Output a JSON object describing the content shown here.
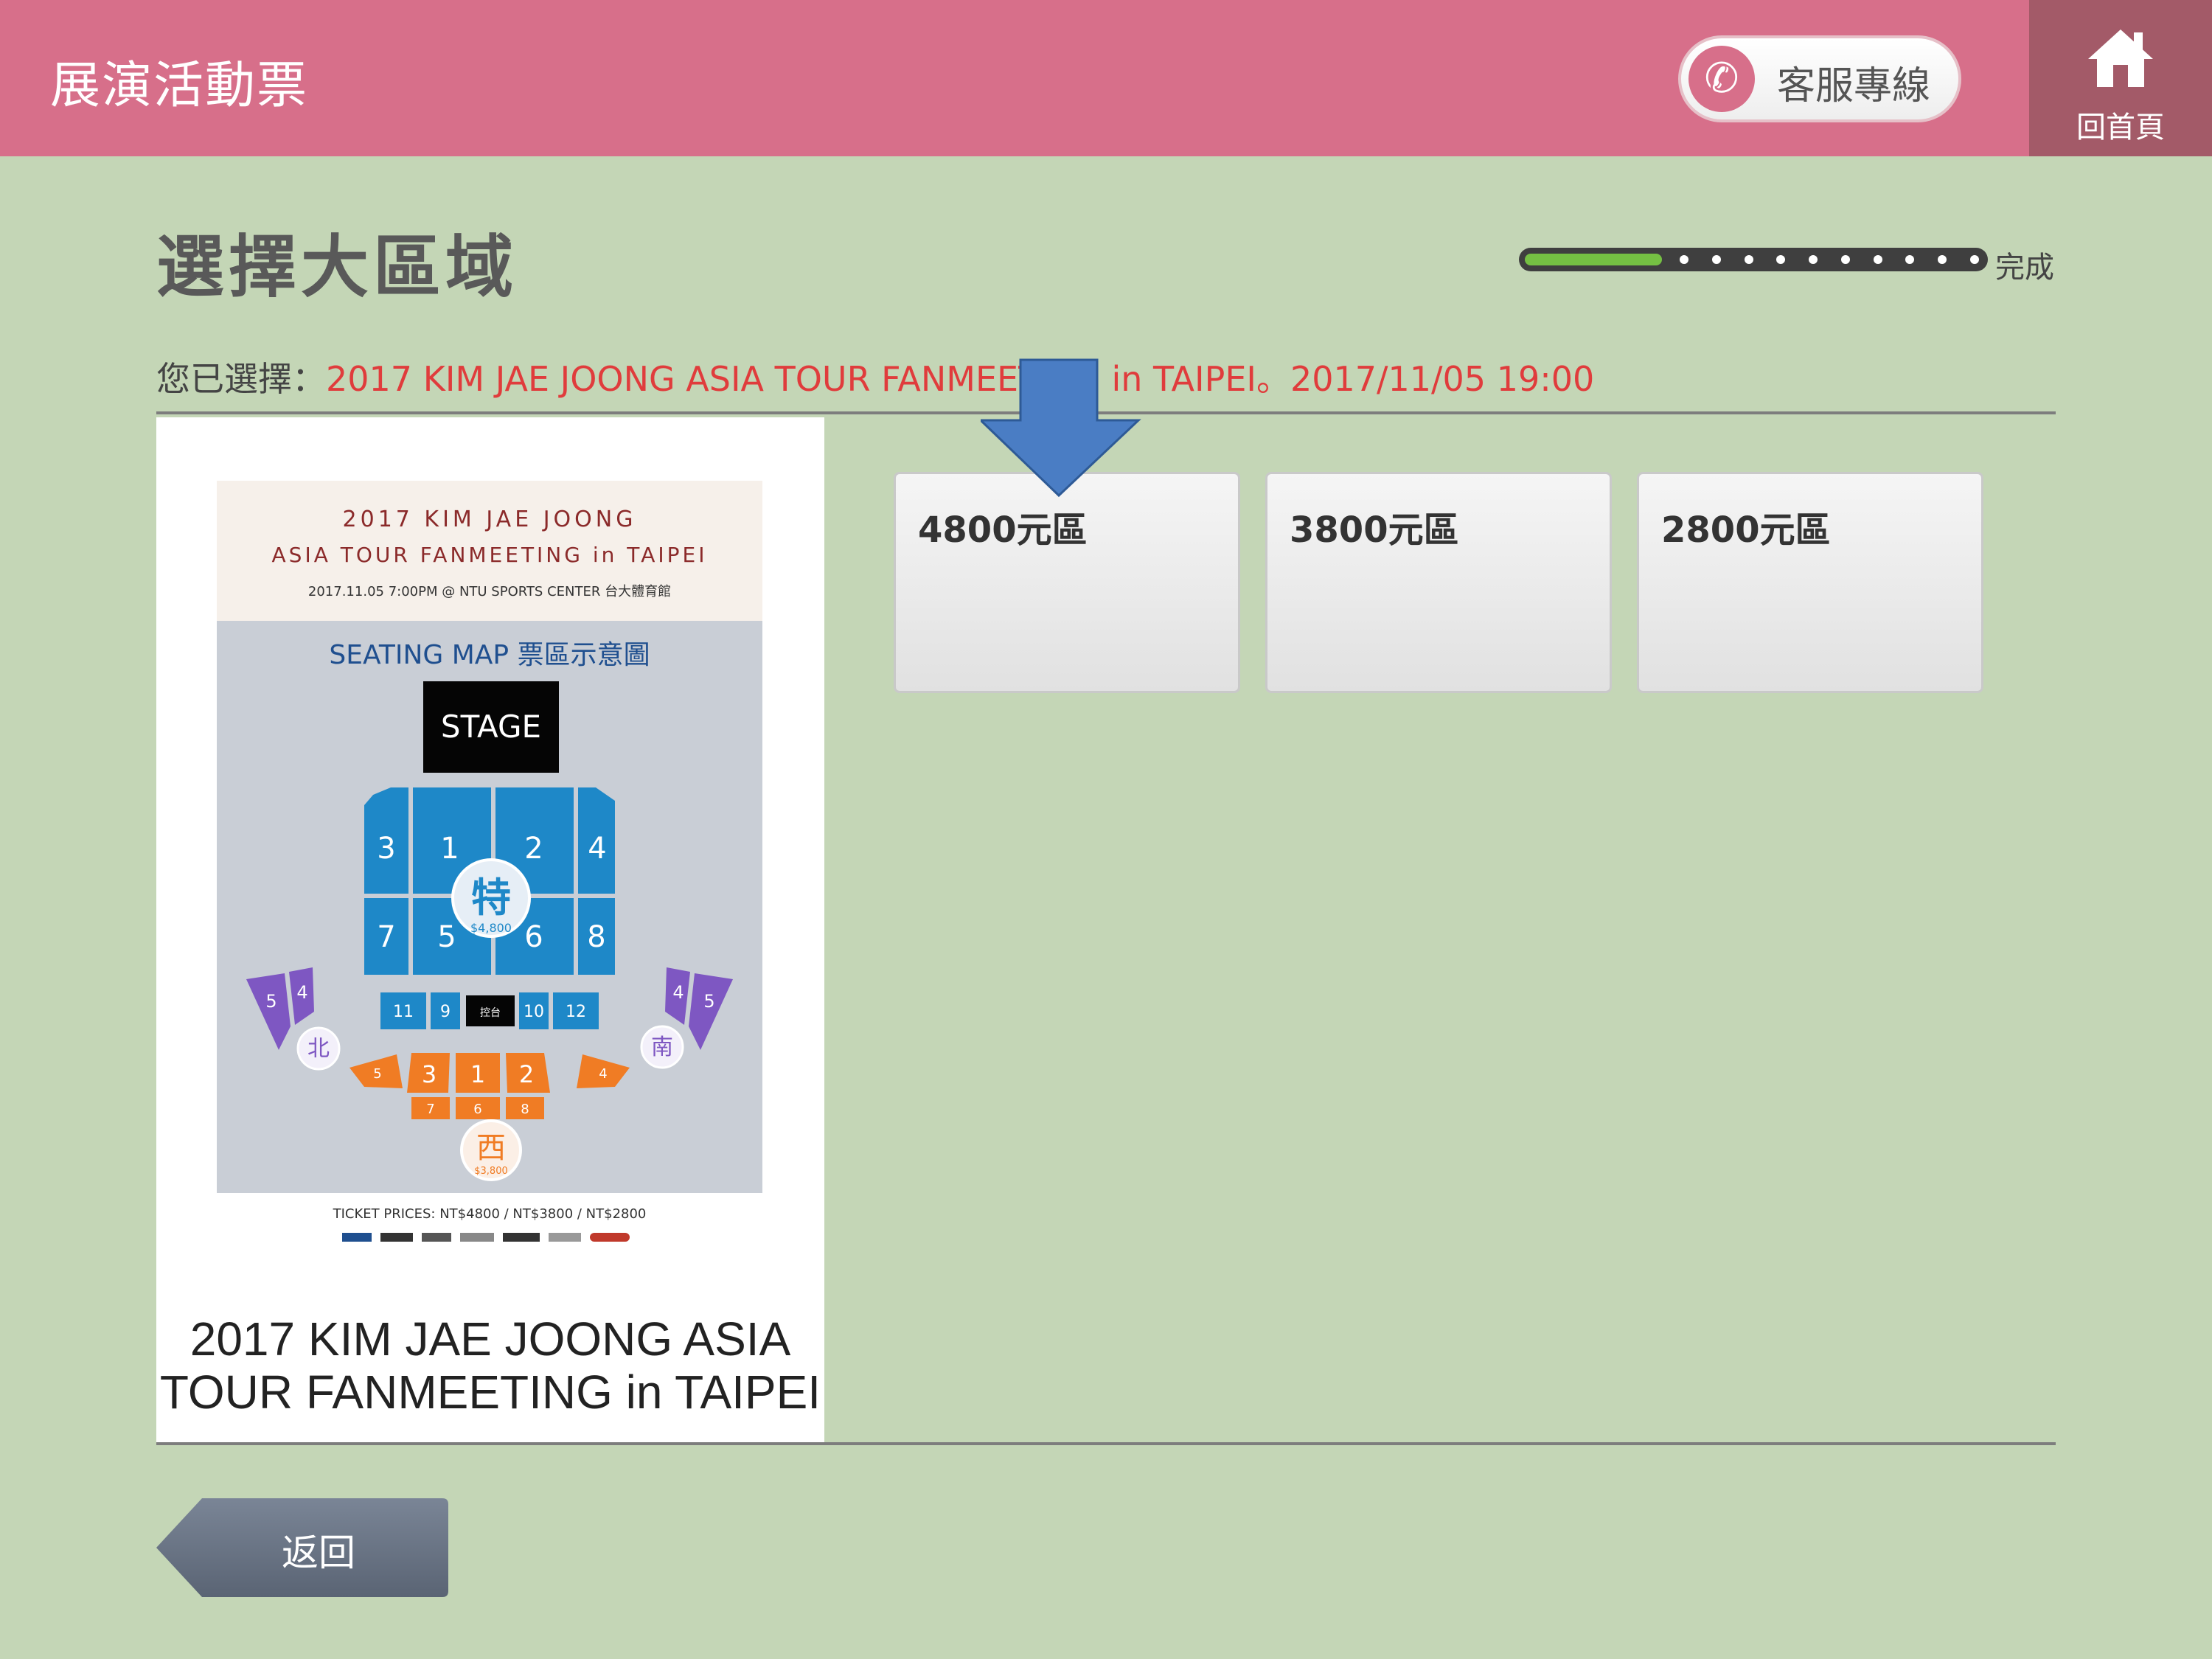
{
  "header": {
    "title": "展演活動票",
    "service_label": "客服專線",
    "home_label": "回首頁"
  },
  "page": {
    "title": "選擇大區域",
    "progress_label": "完成",
    "progress_fraction": 0.3
  },
  "selection": {
    "prefix": "您已選擇：",
    "event": "2017 KIM JAE JOONG ASIA TOUR FANMEETING in TAIPEI。2017/11/05 19:00"
  },
  "poster": {
    "line1": "2017 KIM JAE JOONG",
    "line2": "ASIA TOUR FANMEETING in TAIPEI",
    "line3": "2017.11.05 7:00PM @ NTU SPORTS CENTER 台大體育館",
    "map_title": "SEATING MAP 票區示意圖",
    "stage": "STAGE",
    "special": "特",
    "special_price": "$4,800",
    "north": "北",
    "south": "南",
    "west": "西",
    "west_price": "$3,800",
    "ticket_prices": "TICKET PRICES: NT$4800 / NT$3800 / NT$2800",
    "blocks": {
      "b1": "1",
      "b2": "2",
      "b3": "3",
      "b4": "4",
      "b5": "5",
      "b6": "6",
      "b7": "7",
      "b8": "8",
      "b9": "9",
      "b10": "10",
      "b11": "11",
      "b12": "12",
      "ctrl": "控台",
      "n4": "4",
      "n5": "5",
      "s4": "4",
      "s5": "5",
      "o1": "1",
      "o2": "2",
      "o3": "3",
      "o4": "4",
      "o5": "5",
      "o6": "6",
      "o7": "7",
      "o8": "8"
    }
  },
  "event_name": "2017 KIM JAE JOONG ASIA TOUR FANMEETING in TAIPEI",
  "zones": [
    {
      "label": "4800元區"
    },
    {
      "label": "3800元區"
    },
    {
      "label": "2800元區"
    }
  ],
  "back_label": "返回",
  "colors": {
    "header": "#d76f8a",
    "background": "#c4d6b6",
    "accent_red": "#e03c3c",
    "progress_green": "#75c043",
    "seat_blue": "#1e88c8",
    "seat_purple": "#7e57c2",
    "seat_orange": "#f07c24"
  }
}
